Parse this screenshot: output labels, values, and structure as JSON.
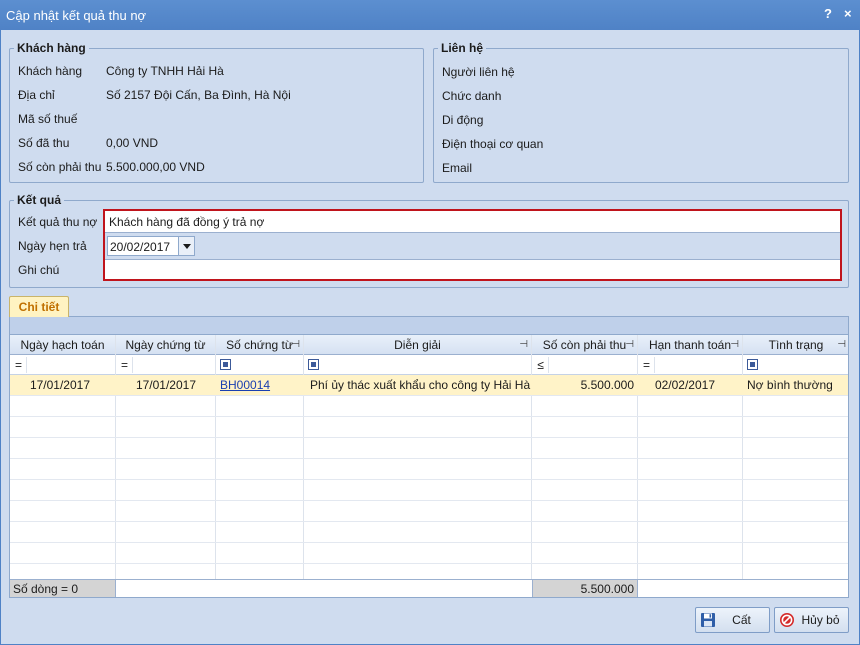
{
  "window": {
    "title": "Cập nhật kết quả thu nợ",
    "help": "?",
    "close": "×"
  },
  "customer": {
    "legend": "Khách hàng",
    "fields": [
      {
        "label": "Khách hàng",
        "value": "Công ty TNHH Hải Hà"
      },
      {
        "label": "Địa chỉ",
        "value": "Số 2157 Đội Cấn, Ba Đình, Hà Nội"
      },
      {
        "label": "Mã số thuế",
        "value": ""
      },
      {
        "label": "Số đã thu",
        "value": "0,00  VND"
      },
      {
        "label": "Số còn phải thu",
        "value": "5.500.000,00  VND"
      }
    ]
  },
  "contact": {
    "legend": "Liên hệ",
    "labels": [
      "Người liên hệ",
      "Chức danh",
      "Di động",
      "Điện thoại cơ quan",
      "Email"
    ]
  },
  "result": {
    "legend": "Kết quả",
    "result_label": "Kết quả thu nợ",
    "result_value": "Khách hàng đã đồng ý trả nợ",
    "due_label": "Ngày hẹn trả",
    "due_value": "20/02/2017",
    "note_label": "Ghi chú",
    "note_value": ""
  },
  "detail": {
    "tab": "Chi tiết",
    "columns": [
      "Ngày hạch toán",
      "Ngày chứng từ",
      "Số chứng từ",
      "Diễn giải",
      "Số còn phải thu",
      "Hạn thanh toán",
      "Tình trạng"
    ],
    "filter_ops": [
      "=",
      "=",
      "",
      "",
      "≤",
      "=",
      ""
    ],
    "rows": [
      {
        "accounting_date": "17/01/2017",
        "voucher_date": "17/01/2017",
        "voucher_no": "BH00014",
        "description": "Phí ủy thác xuất khẩu cho công ty Hải Hà",
        "remaining": "5.500.000",
        "due_date": "02/02/2017",
        "status": "Nợ bình thường"
      }
    ],
    "footer_count": "Số dòng = 0",
    "footer_total": "5.500.000"
  },
  "buttons": {
    "save": "Cất",
    "cancel": "Hủy bỏ"
  },
  "colors": {
    "accent": "#4f82c6",
    "highlight_border": "#c0141c",
    "selected_row": "#fff3c8",
    "link": "#1a3fb0"
  }
}
